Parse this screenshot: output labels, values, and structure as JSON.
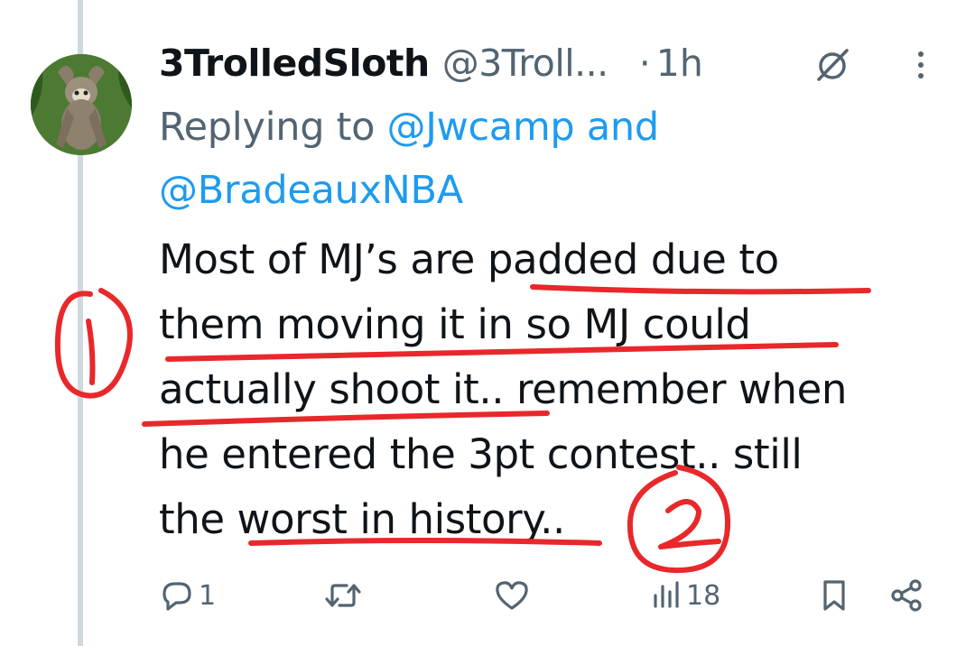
{
  "tweet": {
    "display_name": "3TrolledSloth",
    "handle": "@3Troll...",
    "separator": "·",
    "time": "1h",
    "replying_prefix": "Replying to",
    "reply_mention_1": "@Jwcamp",
    "reply_and": "and",
    "reply_mention_2": "@BradeauxNBA",
    "text_lines": [
      "Most of MJ’s are padded due to",
      "them moving it in so MJ could",
      "actually shoot it.. remember when",
      "he entered the 3pt contest.. still",
      "the worst in history.."
    ]
  },
  "annotations": {
    "mark_1": "1",
    "mark_2": "2",
    "color": "#e8282b"
  },
  "actions": {
    "reply_count": "1",
    "retweet_count": "",
    "like_count": "",
    "views_count": "18"
  },
  "icons": [
    "grok-icon",
    "more-icon",
    "reply-icon",
    "retweet-icon",
    "like-icon",
    "views-icon",
    "bookmark-icon",
    "share-icon"
  ],
  "colors": {
    "link": "#1d9bf0",
    "secondary": "#536471",
    "primary": "#0f1419",
    "thread_line": "#cfd9de"
  }
}
